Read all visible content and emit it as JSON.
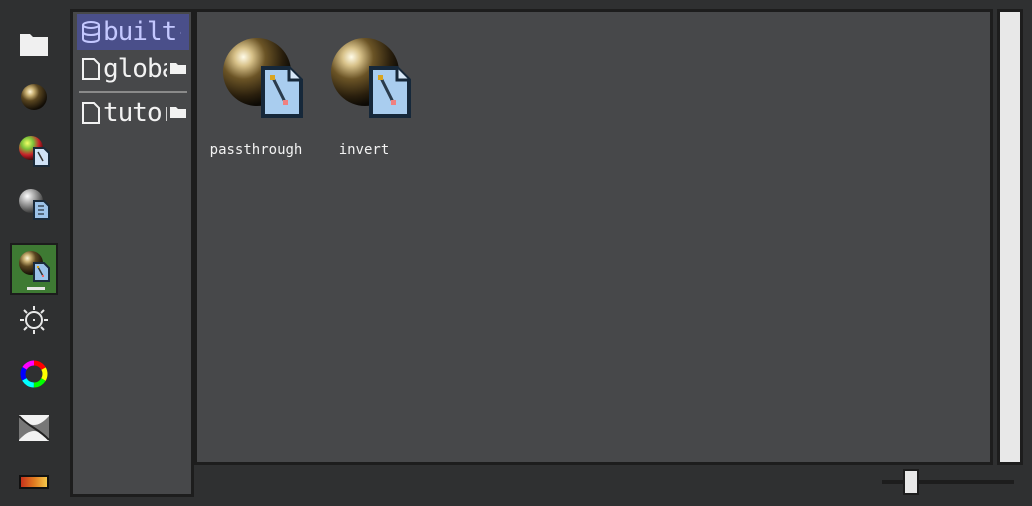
{
  "toolbar": {
    "tools": [
      {
        "icon": "folder-icon"
      },
      {
        "icon": "material-sphere-icon"
      },
      {
        "icon": "color-material-shader-icon"
      },
      {
        "icon": "grey-material-shader-icon"
      },
      {
        "icon": "material-shader-icon",
        "active": true
      },
      {
        "icon": "sun-light-icon"
      },
      {
        "icon": "color-wheel-icon"
      },
      {
        "icon": "curve-editor-icon"
      },
      {
        "icon": "gradient-icon"
      }
    ]
  },
  "sidebar": {
    "items": [
      {
        "label": "built-in",
        "icon": "database-icon",
        "selected": true
      },
      {
        "label": "global",
        "icon": "file-icon",
        "has_folder": true
      },
      {
        "label": "tutorial",
        "icon": "file-icon",
        "has_folder": true
      }
    ]
  },
  "assets": [
    {
      "name": "passthrough",
      "icon": "material-shader-icon"
    },
    {
      "name": "invert",
      "icon": "material-shader-icon"
    }
  ],
  "colors": {
    "background": "#2f3031",
    "panel": "#47484a",
    "selected": "#4a4f8a",
    "active_tool": "#3e7a33"
  }
}
